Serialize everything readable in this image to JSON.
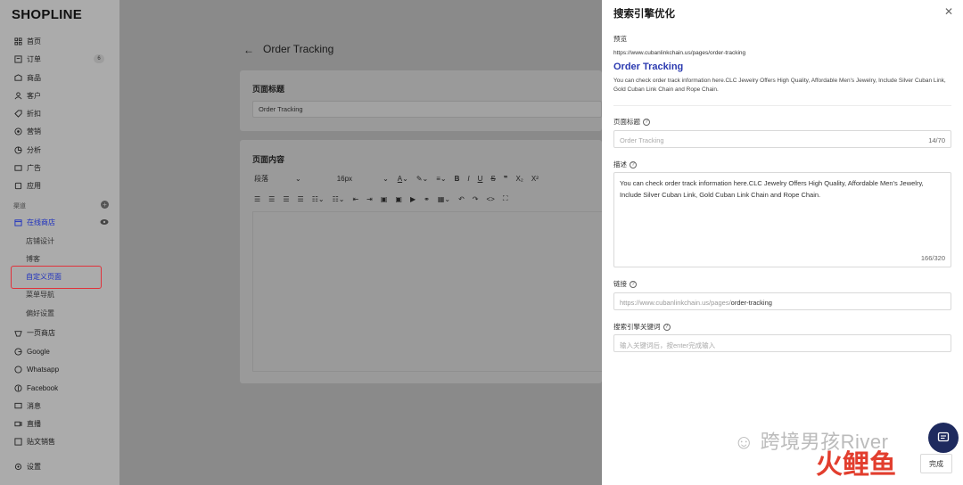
{
  "brand": {
    "logo": "SHOPLINE"
  },
  "sidebar": {
    "items": [
      {
        "label": "首页",
        "icon": "home-icon"
      },
      {
        "label": "订单",
        "icon": "order-icon",
        "badge": "6"
      },
      {
        "label": "商品",
        "icon": "product-icon"
      },
      {
        "label": "客户",
        "icon": "customer-icon"
      },
      {
        "label": "折扣",
        "icon": "discount-icon"
      },
      {
        "label": "营销",
        "icon": "marketing-icon"
      },
      {
        "label": "分析",
        "icon": "analytics-icon"
      },
      {
        "label": "广告",
        "icon": "ads-icon"
      },
      {
        "label": "应用",
        "icon": "apps-icon"
      }
    ],
    "channel_label": "渠道",
    "online_store": "在线商店",
    "sub_items": [
      "店铺设计",
      "博客",
      "自定义页面",
      "菜单导航",
      "偏好设置"
    ],
    "channels": [
      {
        "label": "一页商店",
        "icon": "one-page-icon"
      },
      {
        "label": "Google",
        "icon": "google-icon"
      },
      {
        "label": "Whatsapp",
        "icon": "whatsapp-icon"
      },
      {
        "label": "Facebook",
        "icon": "facebook-icon"
      },
      {
        "label": "消息",
        "icon": "message-icon"
      },
      {
        "label": "直播",
        "icon": "live-icon"
      },
      {
        "label": "贴文销售",
        "icon": "post-sale-icon"
      }
    ],
    "settings": "设置"
  },
  "main": {
    "title": "Order Tracking",
    "page_title_label": "页面标题",
    "page_title_value": "Order Tracking",
    "content_label": "页面内容",
    "toolbar": {
      "paragraph": "段落",
      "font_size": "16px"
    }
  },
  "drawer": {
    "title": "搜索引擎优化",
    "preview_label": "预览",
    "preview_url": "https://www.cubanlinkchain.us/pages/order-tracking",
    "preview_title": "Order Tracking",
    "preview_desc": "You can check order track information here.CLC Jewelry Offers High Quality, Affordable Men's Jewelry, Include Silver Cuban Link, Gold Cuban Link Chain and Rope Chain.",
    "page_title_label": "页面标题",
    "page_title_placeholder": "Order Tracking",
    "page_title_count": "14/70",
    "desc_label": "描述",
    "desc_value": "You can check order track information here.CLC Jewelry Offers High Quality, Affordable Men's Jewelry, Include Silver Cuban Link, Gold Cuban Link Chain and Rope Chain.",
    "desc_count": "166/320",
    "link_label": "链接",
    "link_prefix": "https://www.cubanlinkchain.us/pages/",
    "link_value": "order-tracking",
    "keywords_label": "搜索引擎关键词",
    "keywords_placeholder": "输入关键词后，按enter完成输入",
    "done_label": "完成"
  },
  "watermark": {
    "text": "跨境男孩River",
    "logo_text": "火鲤鱼"
  }
}
